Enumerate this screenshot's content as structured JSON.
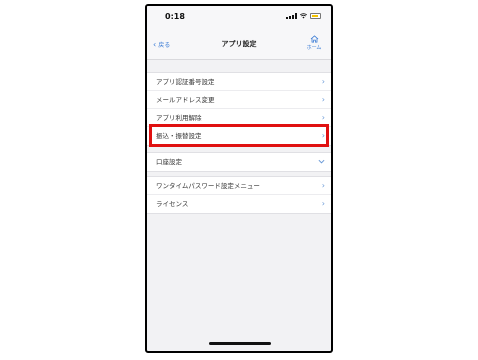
{
  "status_bar": {
    "time": "0:18"
  },
  "nav": {
    "back_label": "戻る",
    "title": "アプリ設定",
    "home_label": "ホーム"
  },
  "groups": [
    {
      "items": [
        {
          "label": "アプリ認証番号設定"
        },
        {
          "label": "メールアドレス変更"
        },
        {
          "label": "アプリ利用解除"
        },
        {
          "label": "振込・振替設定",
          "highlighted": true
        }
      ]
    },
    {
      "items": [
        {
          "label": "口座設定",
          "expandable": true
        }
      ]
    },
    {
      "items": [
        {
          "label": "ワンタイムパスワード設定メニュー"
        },
        {
          "label": "ライセンス"
        }
      ]
    }
  ],
  "colors": {
    "accent": "#3a7bd5",
    "highlight": "#e01010"
  },
  "icons": [
    "signal-icon",
    "wifi-icon",
    "battery-icon",
    "home-icon",
    "chevron-right-icon",
    "chevron-down-icon",
    "chevron-left-icon"
  ]
}
